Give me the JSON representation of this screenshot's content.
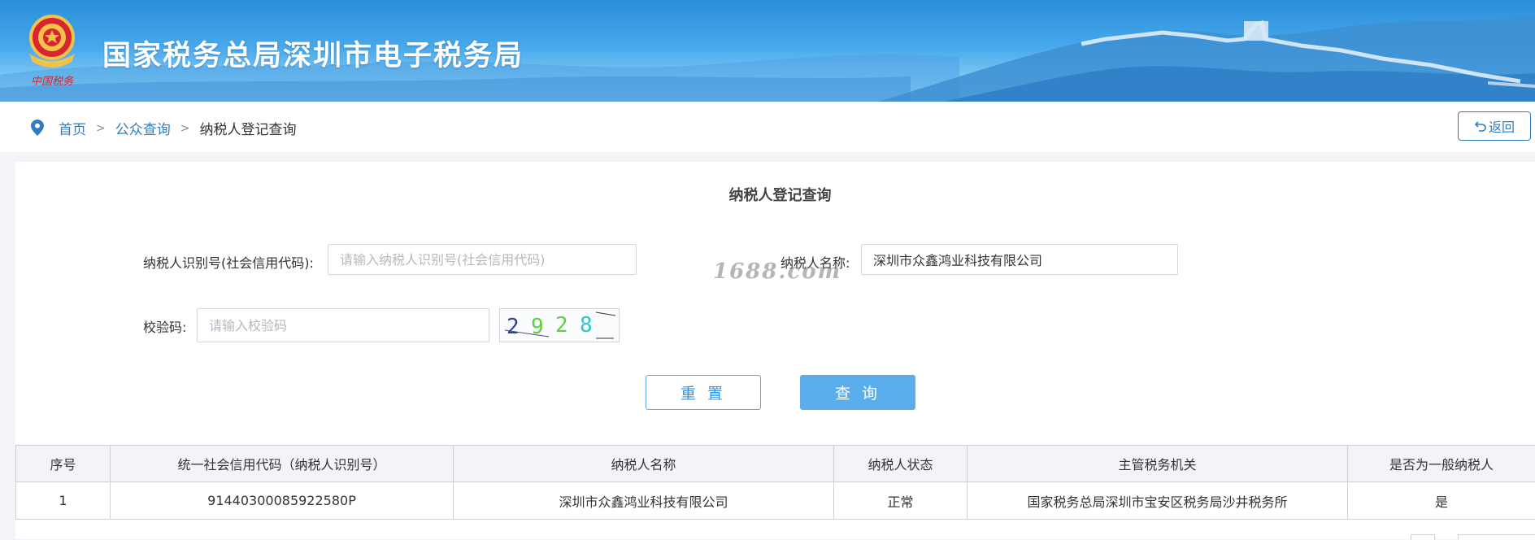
{
  "header": {
    "title": "国家税务总局深圳市电子税务局",
    "emblem_text": "中国税务"
  },
  "breadcrumb": {
    "items": [
      "首页",
      "公众查询"
    ],
    "current": "纳税人登记查询"
  },
  "back_button": {
    "label": "返回",
    "icon": "undo-icon"
  },
  "form": {
    "title": "纳税人登记查询",
    "taxpayer_id": {
      "label": "纳税人识别号(社会信用代码):",
      "placeholder": "请输入纳税人识别号(社会信用代码)",
      "value": ""
    },
    "taxpayer_name": {
      "label": "纳税人名称:",
      "placeholder": "",
      "value": "深圳市众鑫鸿业科技有限公司"
    },
    "captcha": {
      "label": "校验码:",
      "placeholder": "请输入校验码",
      "value": "",
      "image_digits": [
        "2",
        "9",
        "2",
        "8"
      ],
      "image_colors": [
        "#2b3fa8",
        "#58d23a",
        "#5fcf4a",
        "#2ec7c7"
      ]
    },
    "reset_label": "重 置",
    "query_label": "查 询"
  },
  "watermark": "1688.com",
  "table": {
    "headers": [
      "序号",
      "统一社会信用代码（纳税人识别号）",
      "纳税人名称",
      "纳税人状态",
      "主管税务机关",
      "是否为一般纳税人"
    ],
    "rows": [
      [
        "1",
        "91440300085922580P",
        "深圳市众鑫鸿业科技有限公司",
        "正常",
        "国家税务总局深圳市宝安区税务局沙井税务所",
        "是"
      ]
    ]
  },
  "colors": {
    "accent": "#2f7dc0",
    "query_button": "#5aaeec",
    "banner_top": "#2b8fd9"
  }
}
